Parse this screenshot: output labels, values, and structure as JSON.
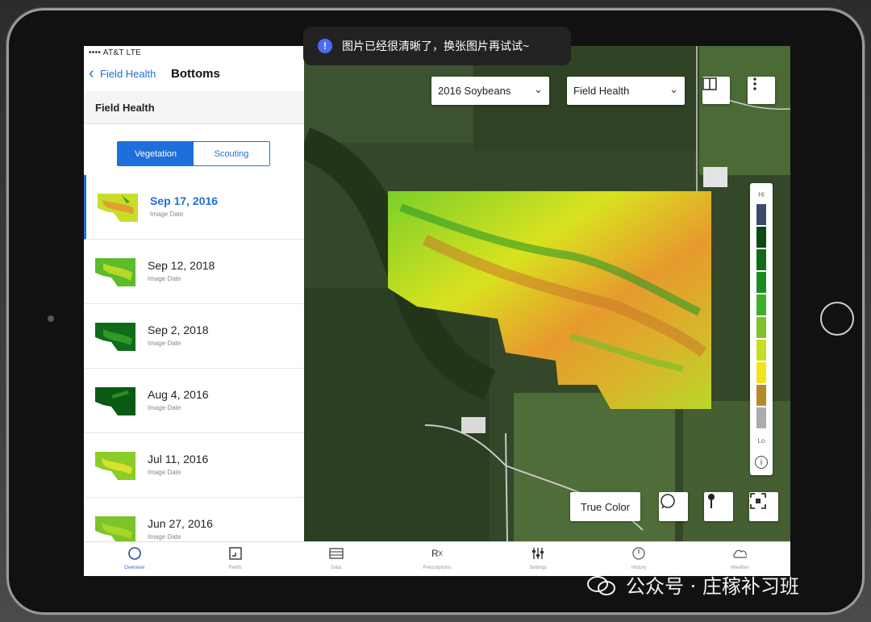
{
  "toast": {
    "message": "图片已经很清晰了，换张图片再试试~"
  },
  "status": {
    "carrier": "•••• AT&T  LTE"
  },
  "sidebar": {
    "back_label": "Field Health",
    "title": "Bottoms",
    "section_title": "Field Health",
    "segments": [
      "Vegetation",
      "Scouting"
    ],
    "dates": [
      {
        "date": "Sep 17, 2016",
        "sub": "Image Date",
        "selected": true
      },
      {
        "date": "Sep 12, 2018",
        "sub": "Image Date"
      },
      {
        "date": "Sep 2, 2018",
        "sub": "Image Date"
      },
      {
        "date": "Aug 4, 2016",
        "sub": "Image Date"
      },
      {
        "date": "Jul 11, 2016",
        "sub": "Image Date"
      },
      {
        "date": "Jun 27, 2016",
        "sub": "Image Date"
      }
    ]
  },
  "map": {
    "crop_select": "2016 Soybeans",
    "layer_select": "Field Health",
    "true_color_label": "True Color",
    "legend": {
      "hi": "Hi",
      "lo": "Lo",
      "info": "i",
      "colors": [
        "#3a4a6e",
        "#0b4a12",
        "#136b1a",
        "#1f8a1f",
        "#3fae2b",
        "#7dc42a",
        "#c6df1e",
        "#f2e317",
        "#b58a2a",
        "#a9adb0"
      ]
    }
  },
  "tabs": [
    "Overview",
    "Fields",
    "Data",
    "Prescriptions",
    "Settings",
    "History",
    "Weather"
  ],
  "watermark": "公众号 · 庄稼补习班"
}
